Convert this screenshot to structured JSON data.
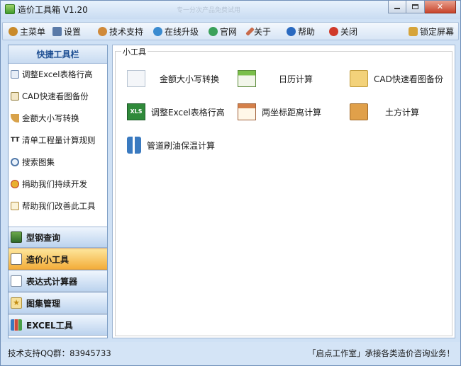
{
  "window": {
    "title": "造价工具箱 V1.20",
    "ghost_title": "专一分次产品免费试用"
  },
  "menu": {
    "items": [
      {
        "label": "主菜单",
        "icon": "user-icon",
        "color": "#c98a2a"
      },
      {
        "label": "设置",
        "icon": "settings-icon",
        "color": "#5a7aa8"
      },
      {
        "label": "技术支持",
        "icon": "support-icon",
        "color": "#d08a3a"
      },
      {
        "label": "在线升级",
        "icon": "globe-icon",
        "color": "#3a8bd0"
      },
      {
        "label": "官网",
        "icon": "home-globe-icon",
        "color": "#3aa05a"
      },
      {
        "label": "关于",
        "icon": "pencil-icon",
        "color": "#c86a4a"
      },
      {
        "label": "帮助",
        "icon": "help-icon",
        "color": "#2a6ac0"
      },
      {
        "label": "关闭",
        "icon": "close-circle-icon",
        "color": "#d03a2a"
      }
    ],
    "lock_label": "锁定屏幕"
  },
  "sidebar": {
    "header": "快捷工具栏",
    "quick_items": [
      {
        "label": "调整Excel表格行高",
        "icon": "document-icon"
      },
      {
        "label": "CAD快速看图备份",
        "icon": "table-icon"
      },
      {
        "label": "金额大小写转换",
        "icon": "ruler-icon"
      },
      {
        "label": "清单工程量计算规则",
        "icon": "text-tt-icon"
      },
      {
        "label": "搜索图集",
        "icon": "search-icon"
      },
      {
        "label": "捐助我们持续开发",
        "icon": "medal-icon"
      },
      {
        "label": "帮助我们改善此工具",
        "icon": "edit-note-icon"
      }
    ],
    "nav": [
      {
        "label": "型钢查询",
        "icon": "steel-icon",
        "active": false
      },
      {
        "label": "造价小工具",
        "icon": "tools-icon",
        "active": true
      },
      {
        "label": "表达式计算器",
        "icon": "calculator-icon",
        "active": false
      },
      {
        "label": "图集管理",
        "icon": "star-folder-icon",
        "active": false
      },
      {
        "label": "EXCEL工具",
        "icon": "bar-chart-icon",
        "active": false
      }
    ]
  },
  "content": {
    "group_title": "小工具",
    "tools": [
      {
        "label": "金额大小写转换",
        "icon": "list-icon"
      },
      {
        "label": "日历计算",
        "icon": "calendar-icon"
      },
      {
        "label": "CAD快速看图备份",
        "icon": "folder-sync-icon"
      },
      {
        "label": "调整Excel表格行高",
        "icon": "xls-icon",
        "icon_text": "XLS"
      },
      {
        "label": "两坐标距离计算",
        "icon": "grid-icon"
      },
      {
        "label": "土方计算",
        "icon": "clipboard-icon"
      },
      {
        "label": "管道刷油保温计算",
        "icon": "pipe-icon"
      }
    ]
  },
  "status": {
    "left": "技术支持QQ群：83945733",
    "right": "「启点工作室」承接各类造价咨询业务！"
  }
}
